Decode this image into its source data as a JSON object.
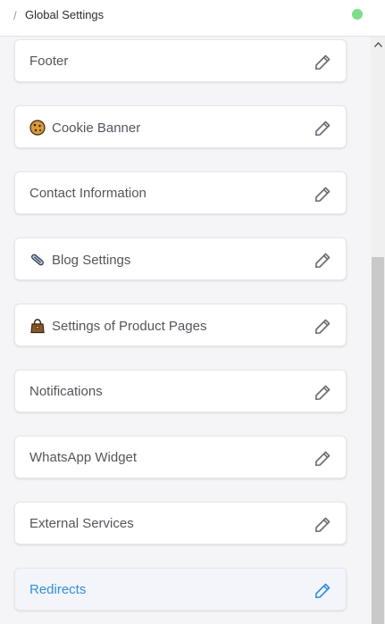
{
  "header": {
    "separator": "/",
    "title": "Global Settings",
    "status_color": "#7fdc8c"
  },
  "colors": {
    "accent": "#2f8fe0",
    "icon": "#6b6b73"
  },
  "items": [
    {
      "label": "Footer",
      "icon": ""
    },
    {
      "label": "Cookie Banner",
      "icon": "cookie-icon"
    },
    {
      "label": "Contact Information",
      "icon": ""
    },
    {
      "label": "Blog Settings",
      "icon": "paperclip-icon"
    },
    {
      "label": "Settings of Product Pages",
      "icon": "handbag-icon"
    },
    {
      "label": "Notifications",
      "icon": ""
    },
    {
      "label": "WhatsApp Widget",
      "icon": ""
    },
    {
      "label": "External Services",
      "icon": ""
    },
    {
      "label": "Redirects",
      "icon": "",
      "active": true
    }
  ]
}
